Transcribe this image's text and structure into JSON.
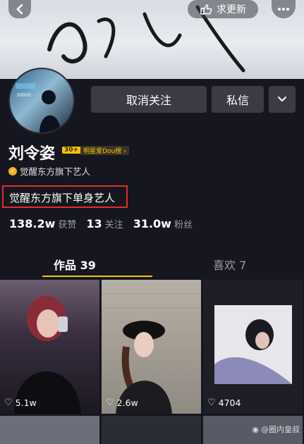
{
  "header": {
    "update_label": "求更新",
    "back_icon": "chevron-left-icon",
    "more_icon": "ellipsis-icon"
  },
  "profile": {
    "name": "刘令姿",
    "level_number": "30+",
    "level_text": "明星爱Dou榜",
    "verify_text": "觉醒东方旗下艺人",
    "bio": "觉醒东方旗下单身艺人",
    "stats": [
      {
        "value": "138.2w",
        "label": "获赞"
      },
      {
        "value": "13",
        "label": "关注"
      },
      {
        "value": "31.0w",
        "label": "粉丝"
      }
    ]
  },
  "actions": {
    "unfollow_label": "取消关注",
    "message_label": "私信",
    "dropdown_icon": "chevron-down-icon"
  },
  "tabs": [
    {
      "label": "作品 39",
      "active": true
    },
    {
      "label": "喜欢 7",
      "active": false
    }
  ],
  "videos": [
    {
      "likes": "5.1w"
    },
    {
      "likes": "2.6w"
    },
    {
      "likes": "4704"
    }
  ],
  "watermark": "@圈内皇叔",
  "colors": {
    "accent": "#f5c400",
    "background": "#15161f",
    "highlight_box": "#e02d2d"
  }
}
